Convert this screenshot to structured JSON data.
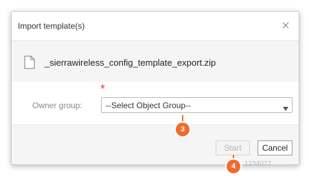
{
  "dialog": {
    "title": "Import template(s)",
    "close_icon": "close-icon"
  },
  "file": {
    "icon": "file-icon",
    "name": "_sierrawireless_config_template_export.zip"
  },
  "form": {
    "required_mark": "*",
    "owner_group_label": "Owner group:",
    "owner_group_selected": "--Select Object Group--",
    "arrow_icon": "triangle-down-icon"
  },
  "footer": {
    "start_label": "Start",
    "cancel_label": "Cancel"
  },
  "background": {
    "ghost_text": "1234077"
  },
  "callouts": [
    {
      "label": "3"
    },
    {
      "label": "4"
    }
  ],
  "colors": {
    "callout": "#ee6c2d",
    "required": "#e8453c"
  }
}
